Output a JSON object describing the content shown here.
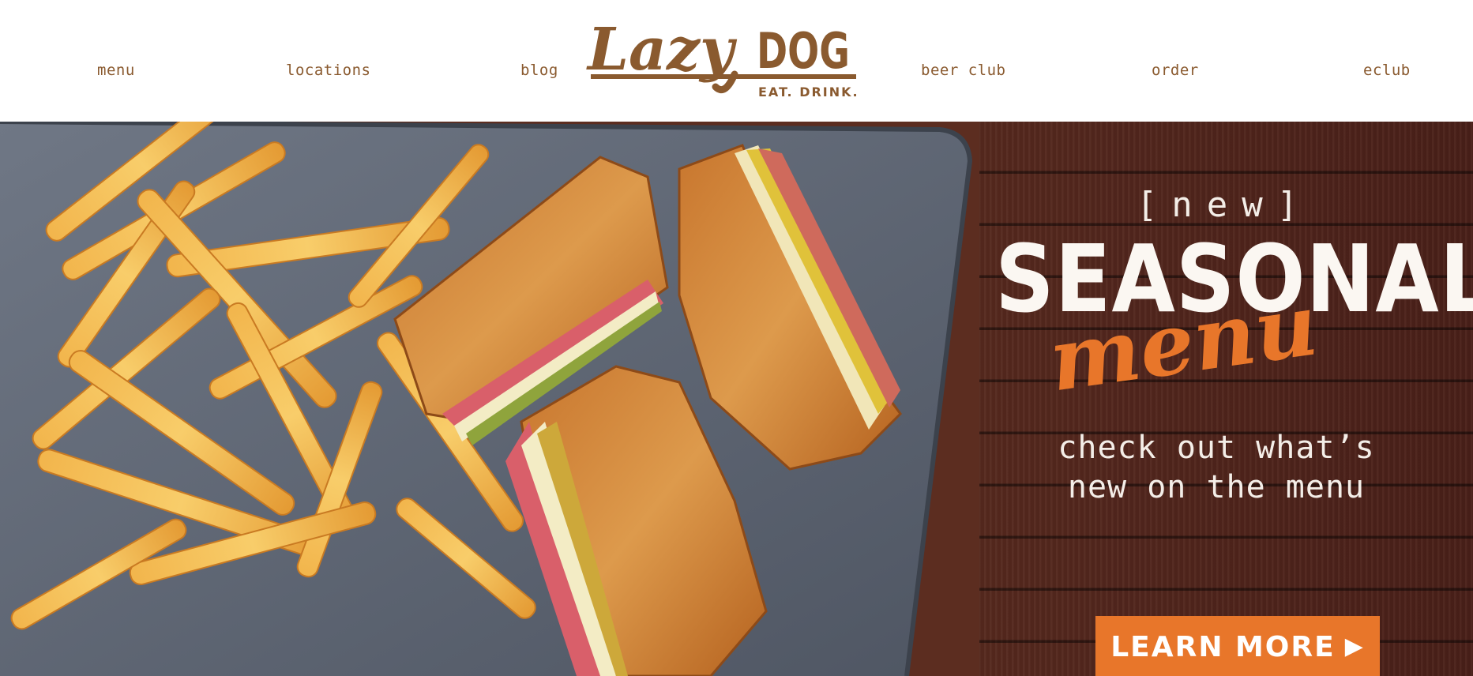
{
  "nav": {
    "items": [
      {
        "label": "menu"
      },
      {
        "label": "locations"
      },
      {
        "label": "blog"
      },
      {
        "label": "beer club"
      },
      {
        "label": "order"
      },
      {
        "label": "eclub"
      }
    ]
  },
  "logo": {
    "primary": "Lazy",
    "secondary": "DOG",
    "tagline": "EAT. DRINK."
  },
  "hero": {
    "tag": "[new]",
    "title": "SEASONAL",
    "script": "menu",
    "description_line1": "check out what’s",
    "description_line2": "new on the menu",
    "cta_label": "LEARN MORE",
    "cta_icon": "play-triangle-icon"
  },
  "colors": {
    "brand_brown": "#8a5a2f",
    "accent_orange": "#e8762a",
    "wood_dark": "#5a2c20",
    "text_light": "#fbf7f2"
  }
}
